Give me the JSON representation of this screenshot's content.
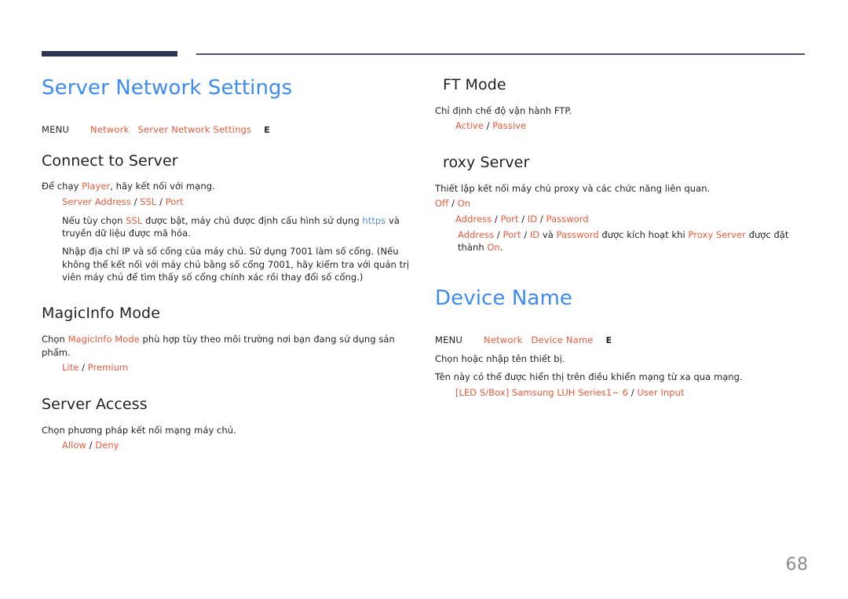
{
  "page": {
    "number": "68",
    "accent_heading": "#3d8bf2",
    "accent_option": "#ef5a3a",
    "rule_color": "#2b3553",
    "text_color": "#231f20"
  },
  "left": {
    "title": "Server Network Settings",
    "menu": {
      "label": "MENU",
      "path1": "Network",
      "path2": "Server Network Settings",
      "key": "E"
    },
    "connect": {
      "heading": "Connect to Server",
      "desc_a": "Để chạy ",
      "desc_hl": "Player",
      "desc_b": ", hãy kết nối với mạng.",
      "options": {
        "o1": "Server Address",
        "o2": "SSL",
        "o3": "Port"
      },
      "note1_a": "Nếu tùy chọn ",
      "note1_hl": "SSL",
      "note1_b": " được bật, máy chủ được định cấu hình sử dụng ",
      "note1_link": "https",
      "note1_c": " và truyền dữ liệu được mã hóa.",
      "note2": "Nhập địa chỉ IP và số cổng của máy chủ. Sử dụng 7001 làm số cổng. (Nếu không thể kết nối với máy chủ bằng số cổng 7001, hãy kiểm tra với quản trị viên máy chủ để tìm thấy số cổng chính xác rồi thay đổi số cổng.)"
    },
    "magicinfo": {
      "heading": "MagicInfo Mode",
      "desc_a": "Chọn ",
      "desc_hl": "MagicInfo Mode",
      "desc_b": " phù hợp tùy theo môi trường nơi bạn đang sử dụng sản phẩm.",
      "options": {
        "o1": "Lite",
        "o2": "Premium"
      }
    },
    "server_access": {
      "heading": "Server Access",
      "desc": "Chọn phương pháp kết nối mạng máy chủ.",
      "options": {
        "o1": "Allow",
        "o2": "Deny"
      }
    }
  },
  "right": {
    "ftp": {
      "heading": "FT  Mode",
      "desc": "Chỉ định chế độ vận hành FTP.",
      "options": {
        "o1": "Active",
        "o2": "Passive"
      }
    },
    "proxy": {
      "heading": "roxy Server",
      "desc": "Thiết lập kết nối máy chủ proxy và các chức năng liên quan.",
      "toggle": {
        "o1": "Off",
        "o2": "On"
      },
      "fields": {
        "f1": "Address",
        "f2": "Port",
        "f3": "ID",
        "f4": "Password"
      },
      "note": {
        "a1": "Address",
        "a2": "Port",
        "a3": "ID",
        "mid1": " và ",
        "a4": "Password",
        "mid2": " được kích hoạt khi ",
        "a5": "Proxy Server",
        "mid3": " được đặt thành ",
        "a6": "On",
        "end": "."
      }
    },
    "device_name": {
      "title": "Device Name",
      "menu": {
        "label": "MENU",
        "path1": "Network",
        "path2": "Device Name",
        "key": "E"
      },
      "desc1": "Chọn hoặc nhập tên thiết bị.",
      "desc2": "Tên này có thể được hiển thị trên điều khiển mạng từ xa qua mạng.",
      "options": {
        "o1": "[LED S/Box] Samsung LUH Series1~ 6",
        "o2": "User Input"
      }
    }
  }
}
